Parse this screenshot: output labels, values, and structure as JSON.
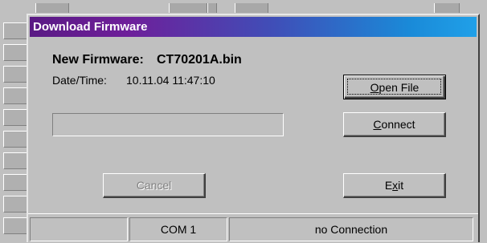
{
  "dialog": {
    "title": "Download Firmware",
    "new_firmware_label": "New Firmware:",
    "new_firmware_value": "CT70201A.bin",
    "datetime_label": "Date/Time:",
    "datetime_value": "10.11.04 11:47:10",
    "progress": 0
  },
  "buttons": {
    "open_file": {
      "prefix": "",
      "accel": "O",
      "suffix": "pen File"
    },
    "connect": {
      "prefix": "",
      "accel": "C",
      "suffix": "onnect"
    },
    "cancel": {
      "label": "Cancel"
    },
    "exit": {
      "prefix": "E",
      "accel": "x",
      "suffix": "it"
    }
  },
  "statusbar": {
    "cell1": "",
    "port": "COM 1",
    "connection": "no Connection"
  }
}
